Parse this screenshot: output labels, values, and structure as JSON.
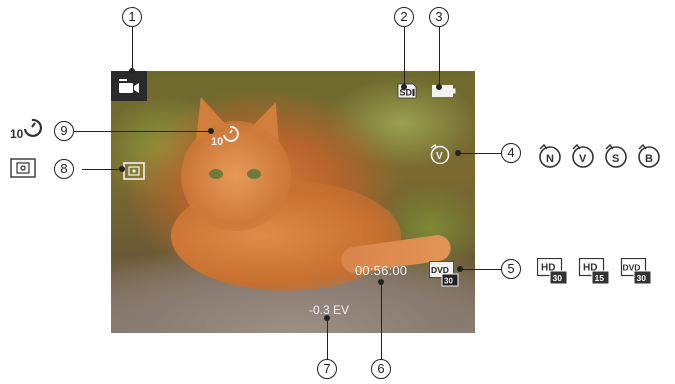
{
  "callouts": [
    "1",
    "2",
    "3",
    "4",
    "5",
    "6",
    "7",
    "8",
    "9"
  ],
  "screen": {
    "time_remaining": "00:56:00",
    "exposure": "-0.3 EV",
    "self_timer_value": "10",
    "scene_badge_letter": "V"
  },
  "scene_options": [
    "N",
    "V",
    "S",
    "B"
  ],
  "video_options": [
    {
      "badge": "HD",
      "fps": "30"
    },
    {
      "badge": "HD",
      "fps": "15"
    },
    {
      "badge": "DVD",
      "fps": "30"
    }
  ],
  "video_selected": {
    "badge": "DVD",
    "fps": "30"
  },
  "self_timer_option": "10",
  "colors": {
    "osd_text": "#f2f2f2",
    "callout_line": "#222222",
    "icon_outline": "#333333"
  }
}
